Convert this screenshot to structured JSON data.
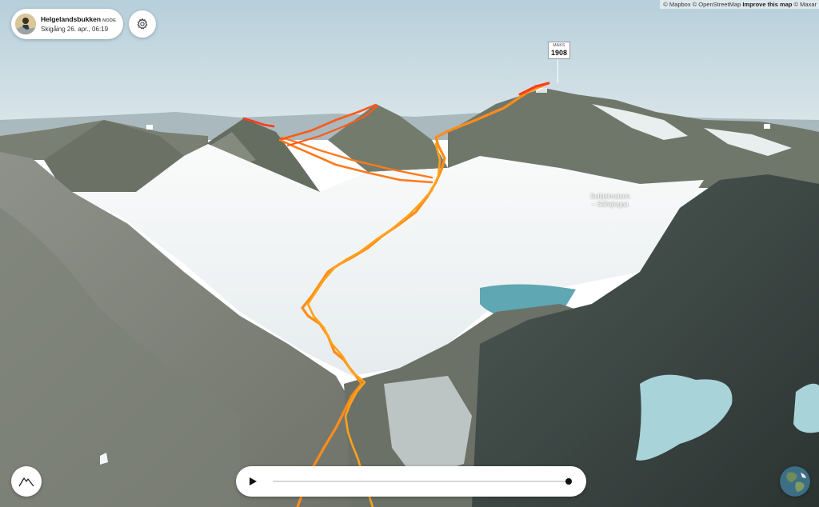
{
  "attribution": {
    "mapbox": "© Mapbox",
    "osm": "© OpenStreetMap",
    "improve": "Improve this map",
    "maxar": "© Maxar"
  },
  "activity_card": {
    "title": "Helgelandsbukken",
    "badge": "NODE",
    "subtitle": "Skigåing 26. apr., 06:19",
    "avatar_icon": "mountain-photo-avatar"
  },
  "settings_button": {
    "icon": "gear-icon"
  },
  "peak_marker": {
    "label": "MAKS",
    "value": "1908"
  },
  "glacier_label": {
    "line1": "Sulitjelmaisen",
    "line2": "– Sállajiegŋa"
  },
  "profile_button": {
    "icon": "elevation-profile-icon"
  },
  "playback": {
    "play_icon": "play-icon",
    "progress": 1.0
  },
  "globe_button": {
    "icon": "globe-icon"
  },
  "colors": {
    "route_primary": "#ff8c1a",
    "route_end": "#ff3b1a",
    "sky_top": "#b9d1dd",
    "sky_bottom": "#dde8ec"
  }
}
